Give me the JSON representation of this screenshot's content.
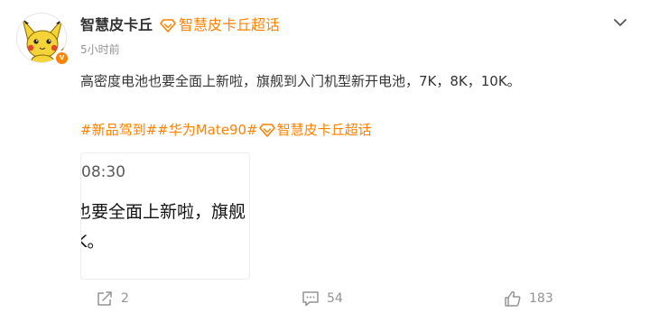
{
  "post": {
    "author": {
      "name": "智慧皮卡丘",
      "verified_badge": "v",
      "supertopic_label": "智慧皮卡丘超话",
      "avatar_icon": "pikachu-avatar"
    },
    "timestamp": "5小时前",
    "text": "高密度电池也要全面上新啦，旗舰到入门机型新开电池，7K，8K，10K。",
    "topics": {
      "topic1": "#新品驾到#",
      "topic2": "#华为Mate90#",
      "topic3": "智慧皮卡丘超话"
    },
    "image": {
      "time": "08:30",
      "line1": "也要全面上新啦，旗舰",
      "line2": "K。"
    },
    "actions": {
      "repost_count": "2",
      "comment_count": "54",
      "like_count": "183"
    },
    "colors": {
      "accent": "#ff8200",
      "muted": "#939393",
      "text": "#333333"
    }
  }
}
